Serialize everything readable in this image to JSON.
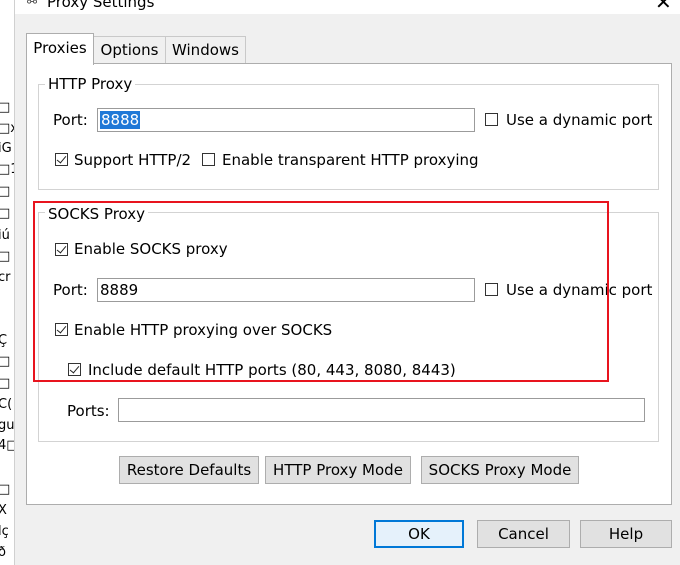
{
  "background_window": {
    "fragments": [
      "□",
      "□x",
      "iG",
      "□1",
      "□",
      "□",
      "iú",
      "□",
      "cr",
      "Ç",
      "□",
      "□",
      "C(",
      "gu",
      "4□",
      "□",
      "X",
      "lç",
      "ð"
    ]
  },
  "dialog": {
    "title": "Proxy Settings",
    "icons": {
      "app": "proxy-app-icon",
      "close": "close-icon"
    }
  },
  "tabs": [
    {
      "label": "Proxies",
      "active": true
    },
    {
      "label": "Options",
      "active": false
    },
    {
      "label": "Windows",
      "active": false
    }
  ],
  "http_proxy": {
    "legend": "HTTP Proxy",
    "port_label": "Port:",
    "port_value": "8888",
    "dynamic_port_label": "Use a dynamic port",
    "dynamic_port_checked": false,
    "support_http2_label": "Support HTTP/2",
    "support_http2_checked": true,
    "transparent_label": "Enable transparent HTTP proxying",
    "transparent_checked": false
  },
  "socks_proxy": {
    "legend": "SOCKS Proxy",
    "enable_label": "Enable SOCKS proxy",
    "enable_checked": true,
    "port_label": "Port:",
    "port_value": "8889",
    "dynamic_port_label": "Use a dynamic port",
    "dynamic_port_checked": false,
    "http_over_socks_label": "Enable HTTP proxying over SOCKS",
    "http_over_socks_checked": true,
    "include_default_label": "Include default HTTP ports (80, 443, 8080, 8443)",
    "include_default_checked": true,
    "ports_label": "Ports:",
    "ports_value": ""
  },
  "mode_buttons": {
    "restore": "Restore Defaults",
    "http_mode": "HTTP Proxy Mode",
    "socks_mode": "SOCKS Proxy Mode"
  },
  "footer_buttons": {
    "ok": "OK",
    "cancel": "Cancel",
    "help": "Help"
  },
  "colors": {
    "highlight_box": "#e8141e",
    "selection": "#1e78d7",
    "primary_border": "#0078d7"
  }
}
